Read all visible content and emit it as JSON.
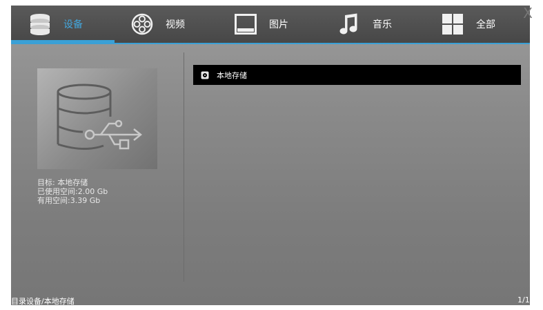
{
  "tabs": [
    {
      "label": "设备",
      "icon": "database-icon",
      "active": true
    },
    {
      "label": "视频",
      "icon": "film-reel-icon",
      "active": false
    },
    {
      "label": "图片",
      "icon": "picture-frame-icon",
      "active": false
    },
    {
      "label": "音乐",
      "icon": "music-note-icon",
      "active": false
    },
    {
      "label": "全部",
      "icon": "grid-icon",
      "active": false
    }
  ],
  "close_label": "X",
  "device_info": {
    "icon": "usb-storage-icon",
    "target": "目标: 本地存储",
    "used": "已使用空间:2.00 Gb",
    "free": "有用空间:3.39 Gb"
  },
  "list": [
    {
      "label": "本地存储",
      "icon": "disk-icon",
      "selected": true
    }
  ],
  "status": {
    "path": "目录设备/本地存储",
    "page": "1/1"
  },
  "colors": {
    "accent": "#3aa0d6",
    "topbar": "#4e4e4e",
    "selected_row": "#000000"
  }
}
